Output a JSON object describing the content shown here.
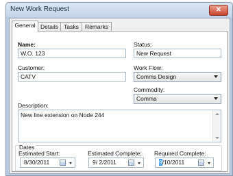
{
  "window": {
    "title": "New Work Request",
    "close_glyph": "✕"
  },
  "tabs": [
    {
      "label": "General",
      "active": true
    },
    {
      "label": "Details",
      "active": false
    },
    {
      "label": "Tasks",
      "active": false
    },
    {
      "label": "Remarks",
      "active": false
    }
  ],
  "form": {
    "name_label": "Name:",
    "name_value": "W.O. 123",
    "status_label": "Status:",
    "status_value": "New Request",
    "customer_label": "Customer:",
    "customer_value": "CATV",
    "workflow_label": "Work Flow:",
    "workflow_value": "Comms Design",
    "commodity_label": "Commodity:",
    "commodity_value": "Comma",
    "description_label": "Description:",
    "description_value": "New line extension on Node 244"
  },
  "dates": {
    "group_label": "Dates",
    "estimated_start_label": "Estimated Start:",
    "estimated_start_value": "8/30/2011",
    "estimated_complete_label": "Estimated Complete:",
    "estimated_complete_value": "9/ 2/2011",
    "required_complete_label": "Required Complete:",
    "required_complete_selected": "9",
    "required_complete_rest": "/10/2011"
  },
  "colors": {
    "selection": "#3399ff",
    "close_button": "#c8432b",
    "frame": "#b8c9e0"
  }
}
